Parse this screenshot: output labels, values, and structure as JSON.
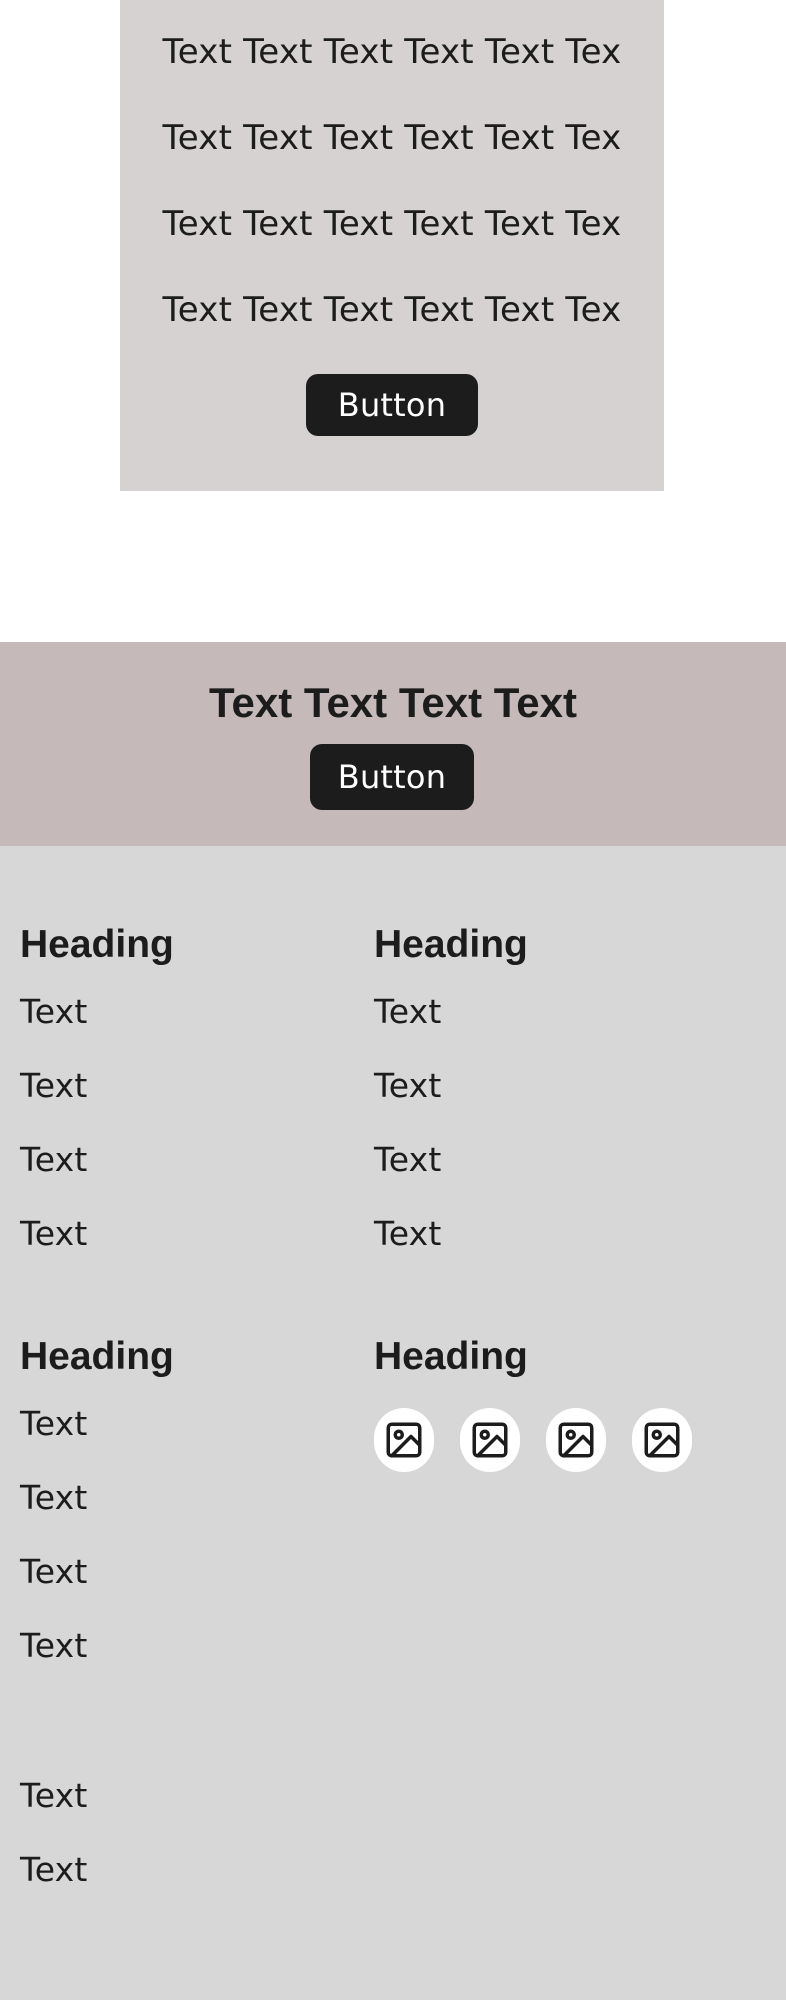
{
  "top_card": {
    "lines": [
      "Text Text Text Text Text Tex",
      "Text Text Text Text Text Tex",
      "Text Text Text Text Text Tex",
      "Text Text Text Text Text Tex"
    ],
    "button_label": "Button",
    "background": "#d6d2d2"
  },
  "banner": {
    "title": "Text Text Text Text",
    "button_label": "Button",
    "background": "#c5b9b9"
  },
  "footer": {
    "background": "#d8d7d8",
    "columns": [
      {
        "heading": "Heading",
        "items": [
          "Text",
          "Text",
          "Text",
          "Text"
        ]
      },
      {
        "heading": "Heading",
        "items": [
          "Text",
          "Text",
          "Text",
          "Text"
        ]
      },
      {
        "heading": "Heading",
        "items": [
          "Text",
          "Text",
          "Text",
          "Text"
        ]
      },
      {
        "heading": "Heading",
        "icons": [
          "image-icon",
          "image-icon",
          "image-icon",
          "image-icon"
        ]
      }
    ],
    "extra_items": [
      "Text",
      "Text"
    ]
  },
  "colors": {
    "button_bg": "#1c1c1c",
    "button_text": "#ffffff",
    "text": "#1c1c1c"
  }
}
